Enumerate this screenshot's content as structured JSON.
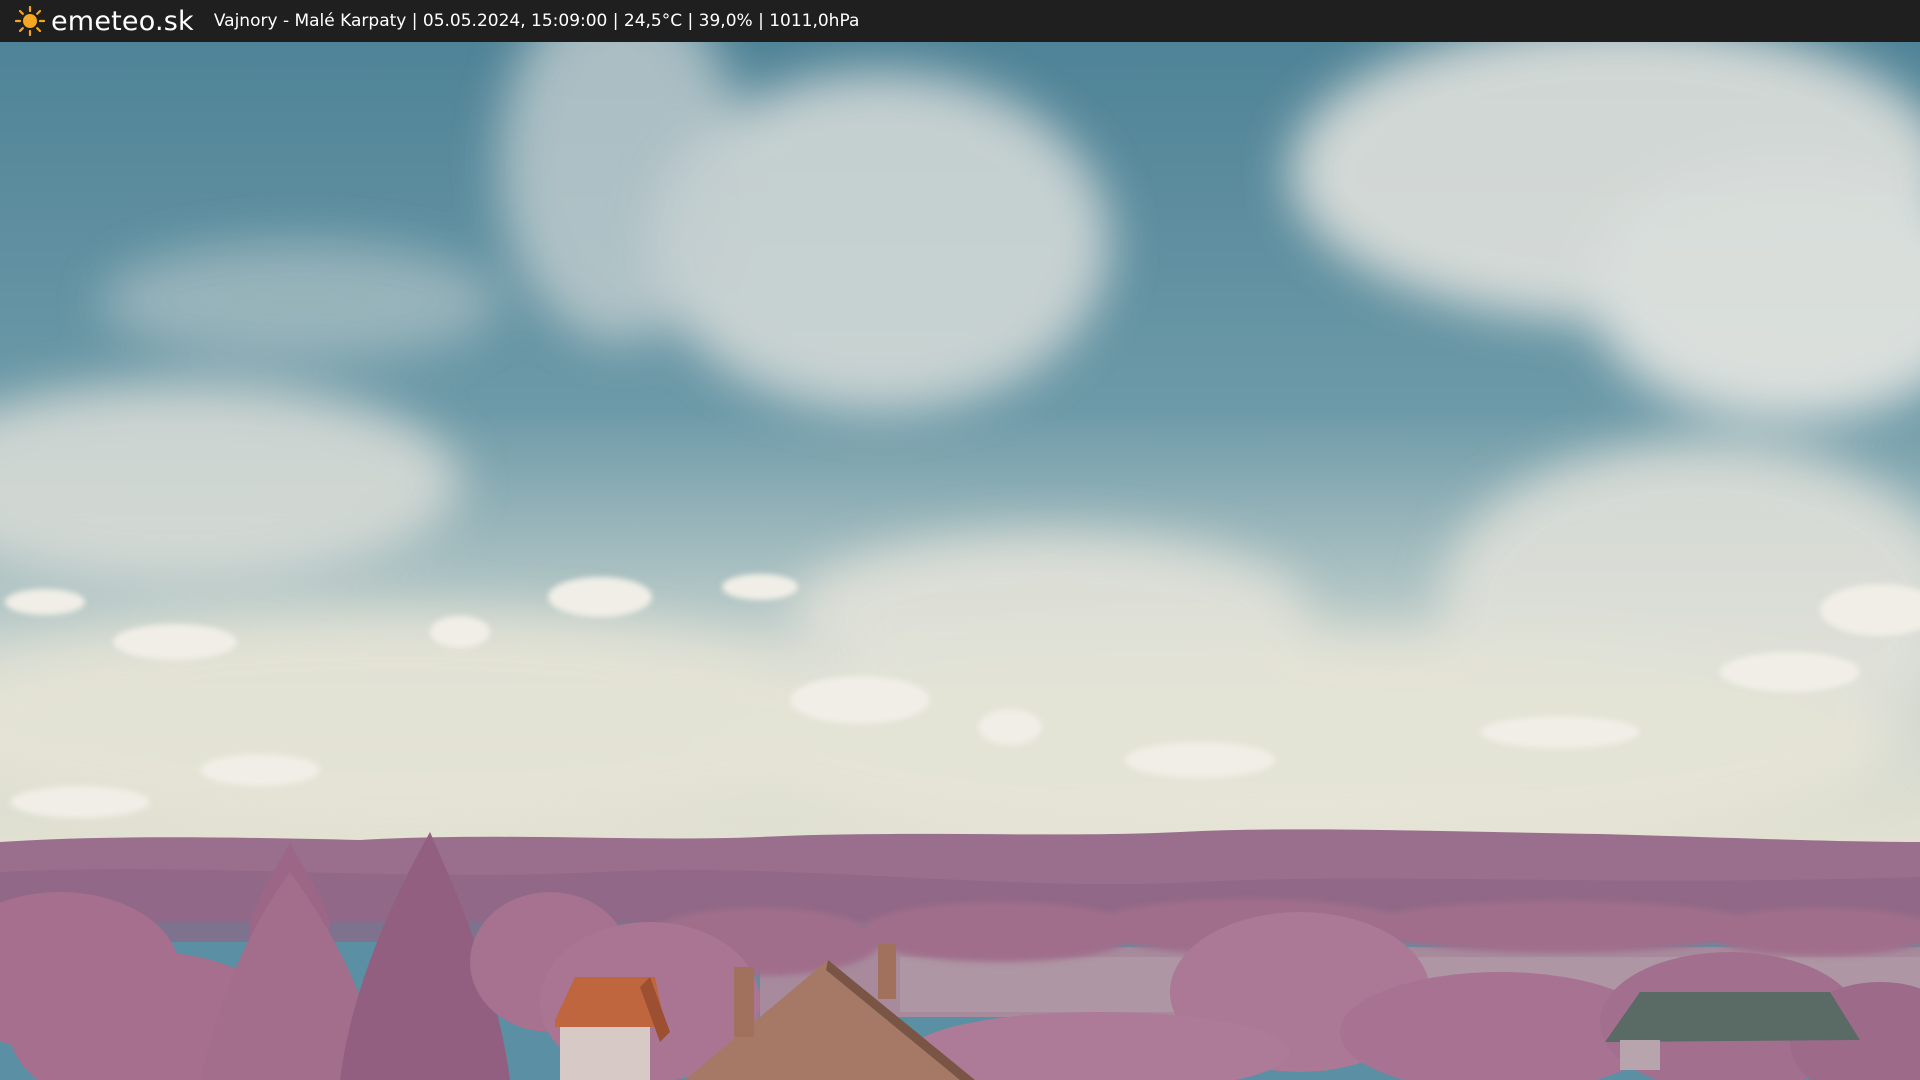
{
  "header": {
    "brand": "emeteo.sk",
    "info": "Vajnory - Malé Karpaty | 05.05.2024, 15:09:00 | 24,5°C | 39,0% | 1011,0hPa",
    "logo_icon": "sun-icon"
  },
  "colors": {
    "topbar": "#1f1f1f",
    "sun": "#f5a623",
    "sky": "#5b8fa3",
    "hills": "#9a6f8e",
    "trees": "#a46f8d",
    "roof": "#c0663f"
  }
}
